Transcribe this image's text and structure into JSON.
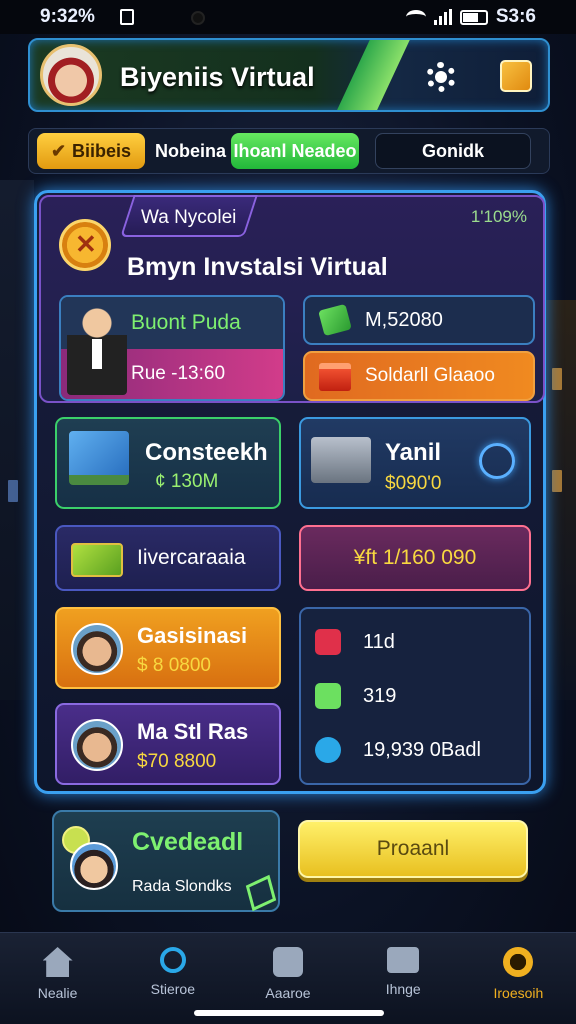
{
  "status": {
    "time": "9:32%",
    "battery": "S3:6"
  },
  "header": {
    "title": "Biyeniis Virtual"
  },
  "tabs": [
    {
      "label": "Biibeis"
    },
    {
      "label": "Nobeina"
    },
    {
      "label": "Ihoanl Neadeo"
    },
    {
      "label": "Gonidk"
    }
  ],
  "panel": {
    "tab_label": "Wa Nycolei",
    "percent": "1'109%",
    "title": "Bmyn Invstalsi Virtual"
  },
  "cards": {
    "bunt": {
      "name": "Buont Puda",
      "value": "Rue -13:60"
    },
    "m": {
      "value": "M,52080"
    },
    "sold": {
      "label": "Soldarll Glaaoo"
    },
    "cons": {
      "name": "Consteekh",
      "value": "¢ 130M"
    },
    "yanil": {
      "name": "Yanil",
      "value": "$090'0"
    },
    "liv": {
      "name": "Iivercaraaia"
    },
    "hft": {
      "value": "¥ft 1/160 090"
    },
    "gas": {
      "name": "Gasisinasi",
      "value": "$ 8 0800"
    },
    "mas": {
      "name": "Ma Stl Ras",
      "value": "$70 8800"
    },
    "stats": [
      {
        "icon": "link-icon",
        "value": "11d",
        "color": "#e0304a"
      },
      {
        "icon": "cube-icon",
        "value": "319",
        "color": "#6ce060"
      },
      {
        "icon": "smiley-icon",
        "value": "19,939 0Badl",
        "color": "#2aa8e8"
      }
    ]
  },
  "lower": {
    "title": "Cvedeadl",
    "subtitle": "Rada Slondks",
    "button": "Proaanl"
  },
  "nav": [
    {
      "label": "Nealie",
      "icon": "home-icon"
    },
    {
      "label": "Stieroe",
      "icon": "search-icon"
    },
    {
      "label": "Aaaroe",
      "icon": "apps-icon"
    },
    {
      "label": "Ihnge",
      "icon": "chat-icon"
    },
    {
      "label": "Iroesoih",
      "icon": "trophy-icon"
    }
  ],
  "colors": {
    "accent": "#3aa0f0",
    "green": "#7ef070",
    "gold": "#f0b020",
    "pink": "#d23c8a"
  }
}
